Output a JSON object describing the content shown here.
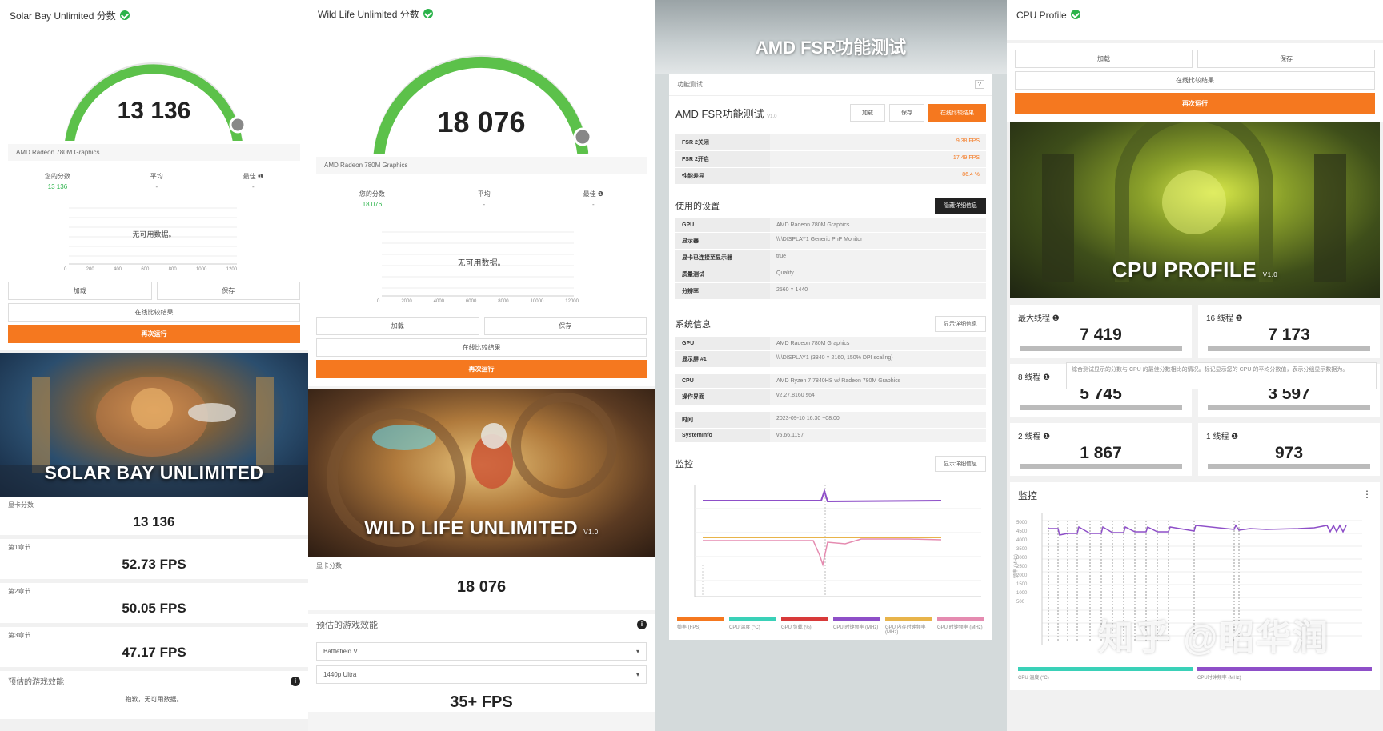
{
  "colors": {
    "green": "#2bb34a",
    "orange": "#f5781f",
    "purple": "#8e4fc8",
    "teal": "#3ad1b8"
  },
  "panel1": {
    "title": "Solar Bay Unlimited 分数",
    "score": "13 136",
    "device": "AMD Radeon 780M Graphics",
    "stats": {
      "yours_label": "您的分数",
      "yours_value": "13 136",
      "avg_label": "平均",
      "avg_value": "-",
      "best_label": "最佳 ❶",
      "best_value": "-"
    },
    "no_data": "无可用数据。",
    "axis_ticks": [
      "0",
      "200",
      "400",
      "600",
      "800",
      "1000",
      "1200"
    ],
    "buttons": {
      "load": "加载",
      "save": "保存",
      "online": "在线比较结果",
      "run": "再次运行"
    },
    "banner": "SOLAR BAY UNLIMITED",
    "results": [
      {
        "label": "显卡分数",
        "value": "13 136"
      },
      {
        "label": "第1章节",
        "value": "52.73 FPS"
      },
      {
        "label": "第2章节",
        "value": "50.05 FPS"
      },
      {
        "label": "第3章节",
        "value": "47.17 FPS"
      }
    ],
    "estimate_label": "预估的游戏效能",
    "estimate_text": "抱歉，无可用数据。"
  },
  "panel2": {
    "title": "Wild Life Unlimited 分数",
    "score": "18 076",
    "device": "AMD Radeon 780M Graphics",
    "stats": {
      "yours_label": "您的分数",
      "yours_value": "18 076",
      "avg_label": "平均",
      "avg_value": "-",
      "best_label": "最佳 ❶",
      "best_value": "-"
    },
    "no_data": "无可用数据。",
    "axis_ticks": [
      "0",
      "2000",
      "4000",
      "6000",
      "8000",
      "10000",
      "12000"
    ],
    "buttons": {
      "load": "加载",
      "save": "保存",
      "online": "在线比较结果",
      "run": "再次运行"
    },
    "banner": "WILD LIFE UNLIMITED",
    "banner_ver": "V1.0",
    "result_label": "显卡分数",
    "result_value": "18 076",
    "estimate_label": "预估的游戏效能",
    "game_select": "Battlefield V",
    "preset_select": "1440p Ultra",
    "fps": "35+ FPS"
  },
  "panel3": {
    "title": "AMD FSR功能测试",
    "tab": "功能测试",
    "sub_title": "AMD FSR功能测试",
    "sub_ver": "V1.0",
    "buttons": {
      "load": "加载",
      "save": "保存",
      "online": "在线比较结果"
    },
    "results": [
      {
        "k": "FSR 2关闭",
        "v": "9.38 FPS"
      },
      {
        "k": "FSR 2开启",
        "v": "17.49 FPS"
      },
      {
        "k": "性能差异",
        "v": "86.4 %"
      }
    ],
    "settings_label": "使用的设置",
    "settings_btn": "隐藏详细信息",
    "settings": [
      {
        "k": "GPU",
        "v": "AMD Radeon 780M Graphics"
      },
      {
        "k": "显示器",
        "v": "\\\\.\\DISPLAY1 Generic PnP Monitor"
      },
      {
        "k": "显卡已连接至显示器",
        "v": "true"
      },
      {
        "k": "质量测试",
        "v": "Quality"
      },
      {
        "k": "分辨率",
        "v": "2560 × 1440"
      }
    ],
    "sysinfo_label": "系统信息",
    "sysinfo_btn": "显示详细信息",
    "sysinfo_a": [
      {
        "k": "GPU",
        "v": "AMD Radeon 780M Graphics"
      },
      {
        "k": "显示屏 #1",
        "v": "\\\\.\\DISPLAY1 (3840 × 2160, 150% DPI scaling)"
      }
    ],
    "sysinfo_b": [
      {
        "k": "CPU",
        "v": "AMD Ryzen 7 7840HS w/ Radeon 780M Graphics"
      },
      {
        "k": "操作界面",
        "v": "v2.27.8160 s64"
      }
    ],
    "sysinfo_c": [
      {
        "k": "时间",
        "v": "2023-09-10 16:30 +08:00"
      },
      {
        "k": "SystemInfo",
        "v": "v5.66.1197"
      }
    ],
    "monitor_label": "监控",
    "monitor_btn": "显示详细信息",
    "legend": [
      "帧率 (FPS)",
      "CPU 温度 (°C)",
      "GPU 负载 (%)",
      "CPU 时钟频率 (MHz)",
      "GPU 内存时钟频率 (MHz)",
      "GPU 时钟频率 (MHz)"
    ],
    "legend_colors": [
      "#f5781f",
      "#3ad1b8",
      "#d83a3a",
      "#8e4fc8",
      "#e8b44a",
      "#e58bb0"
    ]
  },
  "panel4": {
    "title": "CPU Profile",
    "buttons": {
      "load": "加载",
      "save": "保存",
      "online": "在线比较结果",
      "run": "再次运行"
    },
    "banner": "CPU PROFILE",
    "banner_ver": "V1.0",
    "scores": [
      {
        "label": "最大线程 ❶",
        "value": "7 419"
      },
      {
        "label": "16 线程 ❶",
        "value": "7 173"
      },
      {
        "label": "8 线程 ❶",
        "value": "5 745"
      },
      {
        "label": "",
        "value": "3 597"
      },
      {
        "label": "2 线程 ❶",
        "value": "1 867"
      },
      {
        "label": "1 线程 ❶",
        "value": "973"
      }
    ],
    "tooltip": "综合测试显示的分数与 CPU 的最佳分数相比的情况。标记显示您的 CPU 的平均分数值，表示分组显示数据为。",
    "monitor_label": "监控",
    "legend": [
      "CPU 温度 (°C)",
      "CPU时钟频率 (MHz)"
    ],
    "y_ticks": [
      "5000",
      "4500",
      "4000",
      "3500",
      "3000",
      "2500",
      "2000",
      "1500",
      "1000",
      "500"
    ],
    "ylabel": "频率 (MHz)",
    "watermark": "知乎 @昭华润"
  }
}
